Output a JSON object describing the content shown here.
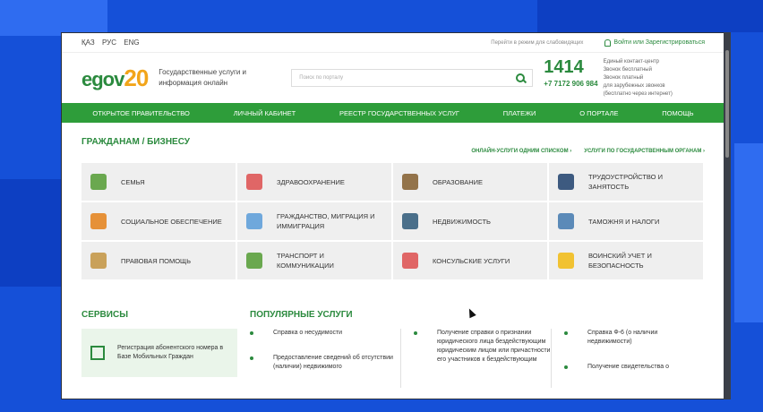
{
  "top": {
    "langs": [
      "ҚАЗ",
      "РУС",
      "ENG"
    ],
    "accessibility": "Перейти в режим для слабовидящих",
    "login": "Войти или Зарегистрироваться"
  },
  "header": {
    "logo_text": "egov",
    "logo_num": "20",
    "tagline": "Государственные услуги и информация онлайн",
    "search_placeholder": "Поиск по порталу",
    "contact_big": "1414",
    "contact_phone": "+7 7172 906 984",
    "contact_lines": [
      "Единый контакт-центр",
      "Звонок бесплатный",
      "Звонок платный",
      "для зарубежных звонков",
      "(бесплатно через интернет)"
    ]
  },
  "nav": [
    "ОТКРЫТОЕ ПРАВИТЕЛЬСТВО",
    "ЛИЧНЫЙ КАБИНЕТ",
    "РЕЕСТР ГОСУДАРСТВЕННЫХ УСЛУГ",
    "ПЛАТЕЖИ",
    "О ПОРТАЛЕ",
    "ПОМОЩЬ"
  ],
  "citizens": {
    "title": "ГРАЖДАНАМ / БИЗНЕСУ",
    "link1": "ОНЛАЙН-УСЛУГИ ОДНИМ СПИСКОМ ›",
    "link2": "УСЛУГИ ПО ГОСУДАРСТВЕННЫМ ОРГАНАМ ›",
    "tiles": [
      {
        "label": "СЕМЬЯ",
        "color": "#6aa84f"
      },
      {
        "label": "ЗДРАВООХРАНЕНИЕ",
        "color": "#e06666"
      },
      {
        "label": "ОБРАЗОВАНИЕ",
        "color": "#93734a"
      },
      {
        "label": "ТРУДОУСТРОЙСТВО И ЗАНЯТОСТЬ",
        "color": "#3d5a80"
      },
      {
        "label": "СОЦИАЛЬНОЕ ОБЕСПЕЧЕНИЕ",
        "color": "#e69138"
      },
      {
        "label": "ГРАЖДАНСТВО, МИГРАЦИЯ И ИММИГРАЦИЯ",
        "color": "#6fa8dc"
      },
      {
        "label": "НЕДВИЖИМОСТЬ",
        "color": "#4a6f8a"
      },
      {
        "label": "ТАМОЖНЯ И НАЛОГИ",
        "color": "#5b8ab8"
      },
      {
        "label": "ПРАВОВАЯ ПОМОЩЬ",
        "color": "#c9a15a"
      },
      {
        "label": "ТРАНСПОРТ И КОММУНИКАЦИИ",
        "color": "#6aa84f"
      },
      {
        "label": "КОНСУЛЬСКИЕ УСЛУГИ",
        "color": "#e06666"
      },
      {
        "label": "ВОИНСКИЙ УЧЕТ И БЕЗОПАСНОСТЬ",
        "color": "#f1c232"
      }
    ]
  },
  "services": {
    "title": "СЕРВИСЫ",
    "card": "Регистрация абонентского номера в Базе Мобильных Граждан"
  },
  "popular": {
    "title": "ПОПУЛЯРНЫЕ УСЛУГИ",
    "cols": [
      [
        "Справка о несудимости",
        "Предоставление сведений об отсутствии (наличии) недвижимого"
      ],
      [
        "Получение справки о признании юридического лица бездействующим юридическим лицом или причастности его участников к бездействующим"
      ],
      [
        "Справка Ф-6 (о наличии недвижимости)",
        "Получение свидетельства о"
      ]
    ]
  }
}
